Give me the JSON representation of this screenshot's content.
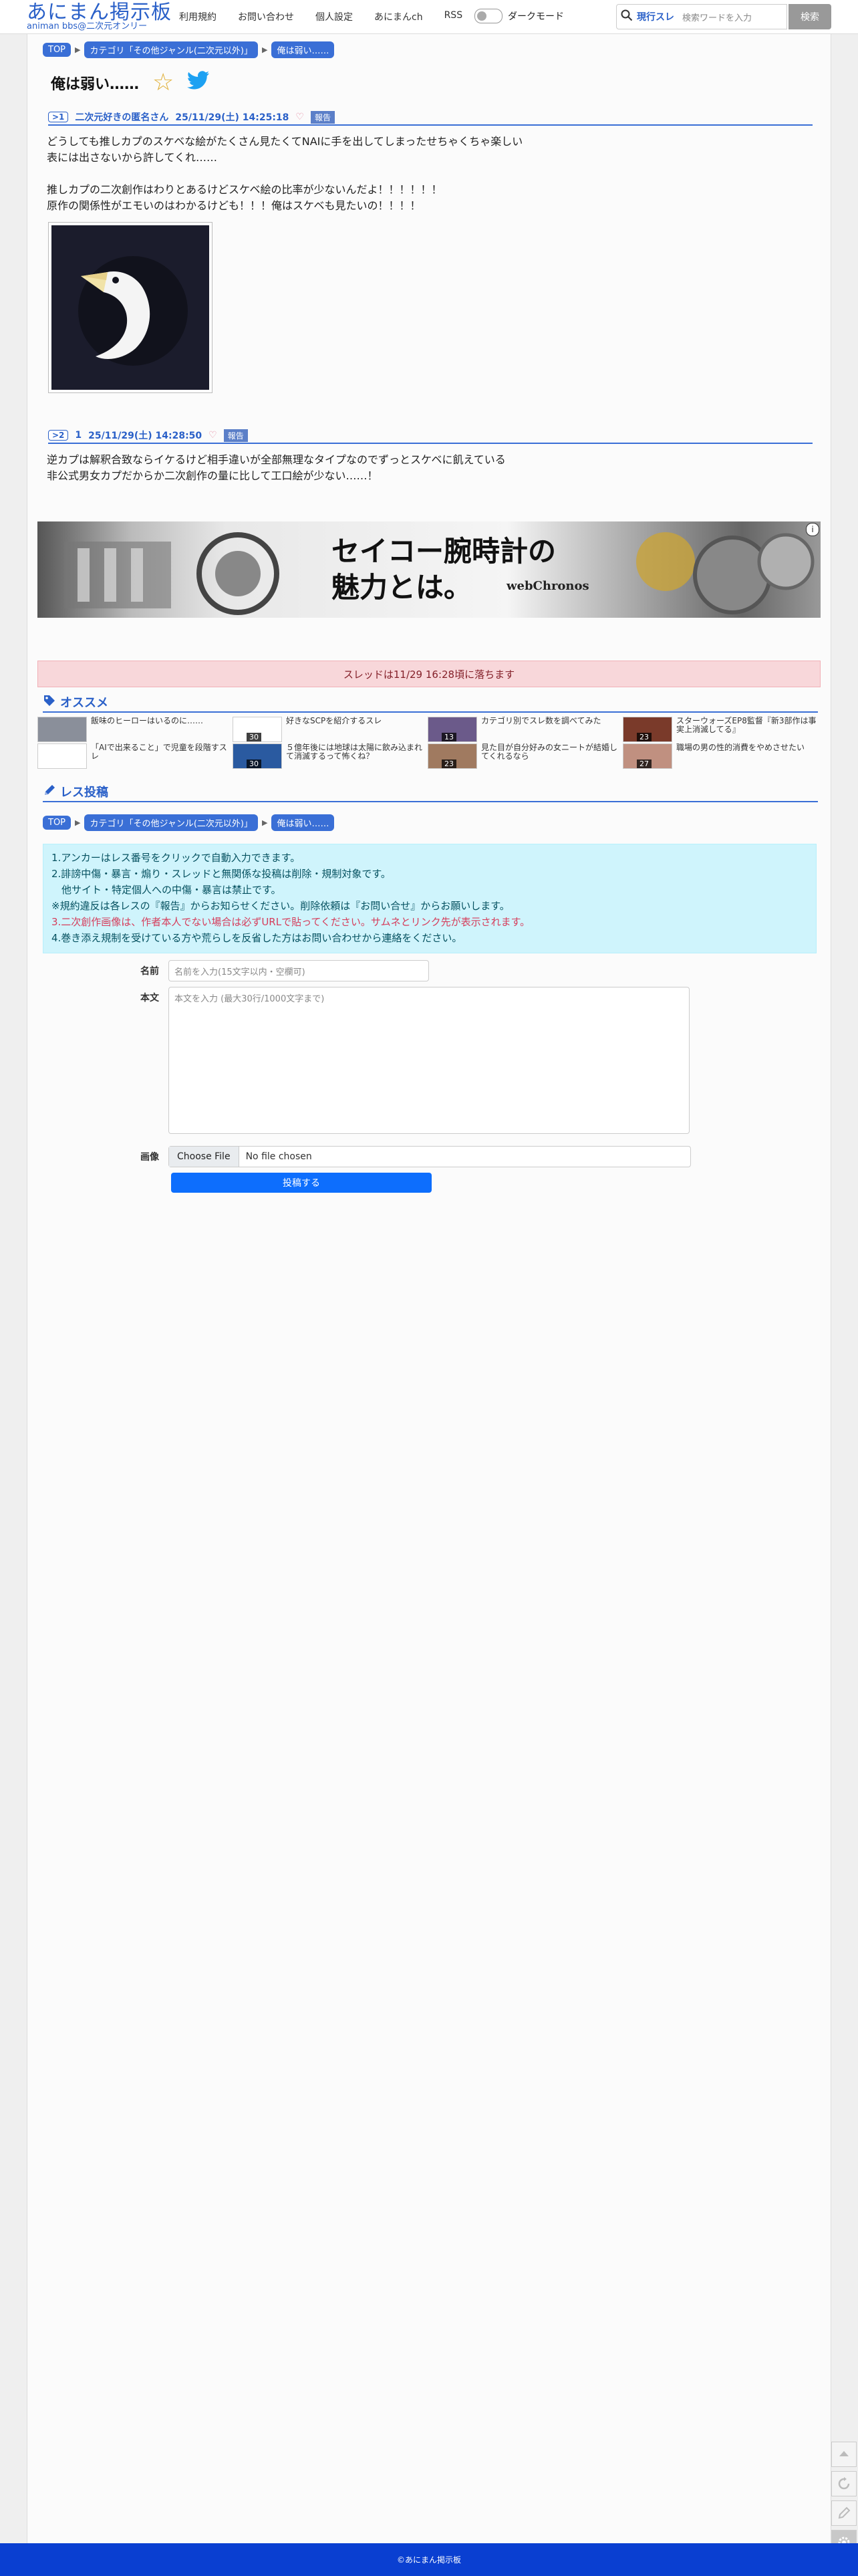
{
  "header": {
    "logo_main": "あにまん掲示板",
    "logo_sub": "animan bbs@二次元オンリー",
    "nav": [
      "利用規約",
      "お問い合わせ",
      "個人設定",
      "あにまんch",
      "RSS"
    ],
    "dark_mode_label": "ダークモード",
    "search_label": "現行スレ",
    "search_placeholder": "検索ワードを入力",
    "search_button": "検索"
  },
  "breadcrumb": [
    "TOP",
    "カテゴリ「その他ジャンル(二次元以外)」",
    "俺は弱い……"
  ],
  "thread_title": "俺は弱い……",
  "posts": [
    {
      "no": ">1",
      "name": "二次元好きの匿名さん",
      "date": "25/11/29(土) 14:25:18",
      "report": "報告",
      "lines": [
        "どうしても推しカプのスケベな絵がたくさん見たくてNAIに手を出してしまったせちゃくちゃ楽しい",
        "表には出さないから許してくれ……",
        "",
        "推しカプの二次創作はわりとあるけどスケベ絵の比率が少ないんだよ！！！！！！",
        "原作の関係性がエモいのはわかるけども！！！俺はスケベも見たいの！！！！"
      ]
    },
    {
      "no": ">2",
      "name": "1",
      "date": "25/11/29(土) 14:28:50",
      "report": "報告",
      "lines": [
        "逆カプは解釈合致ならイケるけど相手違いが全部無理なタイプなのでずっとスケベに飢えている",
        "非公式男女カプだからか二次創作の量に比して工口絵が少ない……！"
      ]
    }
  ],
  "ad": {
    "line1": "セイコー腕時計の",
    "line2": "魅力とは。",
    "brand": "webChronos",
    "info_icon": "i"
  },
  "alert": "スレッドは11/29 16:28頃に落ちます",
  "recommend": {
    "heading": "オススメ",
    "items": [
      {
        "title": "飯味のヒーローはいるのに……",
        "count": "",
        "thumb_color": "#8a8f9a"
      },
      {
        "title": "好きなSCPを紹介するスレ",
        "count": "30",
        "thumb_color": "#ffffff"
      },
      {
        "title": "カテゴリ別でスレ数を調べてみた",
        "count": "13",
        "thumb_color": "#6b5a8a"
      },
      {
        "title": "スターウォーズEP8監督『新3部作は事実上消滅してる』",
        "count": "23",
        "thumb_color": "#7a3a2a"
      },
      {
        "title": "「AIで出来ること」で児童を段階すスレ",
        "count": "",
        "thumb_color": "#ffffff"
      },
      {
        "title": "５億年後には地球は太陽に飲み込まれて消滅するって怖くね？",
        "count": "30",
        "thumb_color": "#2a5aa0"
      },
      {
        "title": "見た目が自分好みの女ニートが結婚してくれるなら",
        "count": "23",
        "thumb_color": "#a07a60"
      },
      {
        "title": "職場の男の性的消費をやめさせたい",
        "count": "27",
        "thumb_color": "#c09080"
      }
    ]
  },
  "reply": {
    "heading": "レス投稿",
    "rules": [
      "1.アンカーはレス番号をクリックで自動入力できます。",
      "2.誹謗中傷・暴言・煽り・スレッドと無関係な投稿は削除・規制対象です。",
      "　他サイト・特定個人への中傷・暴言は禁止です。",
      "※規約違反は各レスの『報告』からお知らせください。削除依頼は『お問い合せ』からお願いします。",
      "3.二次創作画像は、作者本人でない場合は必ずURLで貼ってください。サムネとリンク先が表示されます。",
      "4.巻き添え規制を受けている方や荒らしを反省した方はお問い合わせから連絡をください。"
    ],
    "name_label": "名前",
    "name_placeholder": "名前を入力(15文字以内・空欄可)",
    "body_label": "本文",
    "body_placeholder": "本文を入力 (最大30行/1000文字まで)",
    "image_label": "画像",
    "choose_file": "Choose File",
    "no_file": "No file chosen",
    "submit": "投稿する"
  },
  "footer": "©あにまん掲示板",
  "icons": [
    "search-icon",
    "star-icon",
    "twitter-bird-icon",
    "heart-icon",
    "tag-icon",
    "pencil-icon",
    "scroll-top-icon",
    "reload-icon",
    "edit-icon",
    "settings-gear-icon"
  ]
}
